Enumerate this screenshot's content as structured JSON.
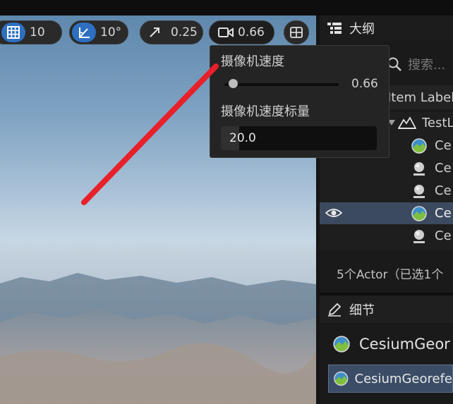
{
  "toolbar": {
    "grid_snap_value": "10",
    "rotation_snap_value": "10°",
    "scale_snap_value": "0.25",
    "camera_speed_value": "0.66"
  },
  "camera_popup": {
    "speed_label": "摄像机速度",
    "speed_value": "0.66",
    "speed_fraction": 0.04,
    "scalar_label": "摄像机速度标量",
    "scalar_value": "20.0"
  },
  "outliner": {
    "title": "大纲",
    "search_placeholder": "搜索...",
    "column_header": "Item Label",
    "folder_label": "TestL",
    "rows": [
      {
        "label": "Ce",
        "icon": "georeference-icon"
      },
      {
        "label": "Ce",
        "icon": "sunsky-icon"
      },
      {
        "label": "Ce",
        "icon": "sunsky-icon"
      },
      {
        "label": "Ce",
        "icon": "georeference-icon",
        "selected": true
      },
      {
        "label": "Ce",
        "icon": "sunsky-icon"
      }
    ],
    "status": "5个Actor（已选1个"
  },
  "details": {
    "title": "细节",
    "actor_name": "CesiumGeor",
    "component_name": "CesiumGeorefe"
  },
  "colors": {
    "accent": "#2f6fbf",
    "selection": "#3c4a5f",
    "annotation": "#e8202a"
  }
}
